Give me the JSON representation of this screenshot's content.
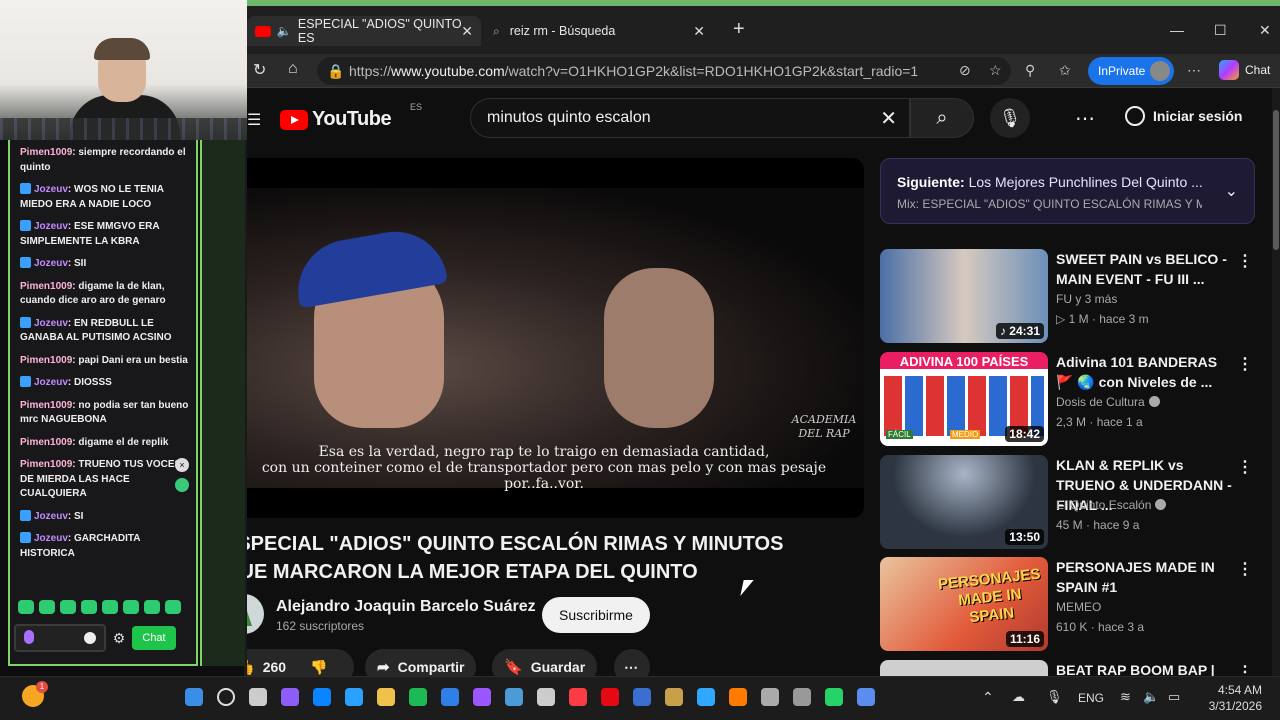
{
  "chat": {
    "messages": [
      {
        "user": "Pimen1009",
        "text": "siempre recordando el quinto",
        "badge": false
      },
      {
        "user": "Jozeuv",
        "text": "WOS NO LE TENIA MIEDO ERA A NADIE LOCO",
        "badge": true
      },
      {
        "user": "Jozeuv",
        "text": "ESE MMGVO ERA SIMPLEMENTE LA KBRA",
        "badge": true
      },
      {
        "user": "Jozeuv",
        "text": "SII",
        "badge": true
      },
      {
        "user": "Pimen1009",
        "text": "digame la de klan, cuando dice aro aro de genaro",
        "badge": false
      },
      {
        "user": "Jozeuv",
        "text": "EN REDBULL LE GANABA AL PUTISIMO ACSINO",
        "badge": true
      },
      {
        "user": "Pimen1009",
        "text": "papi Dani era un bestia",
        "badge": false
      },
      {
        "user": "Jozeuv",
        "text": "DIOSSS",
        "badge": true
      },
      {
        "user": "Pimen1009",
        "text": "no podia ser tan bueno mrc NAGUEBONA",
        "badge": false
      },
      {
        "user": "Pimen1009",
        "text": "digame el de replik",
        "badge": false
      },
      {
        "user": "Pimen1009",
        "text": "TRUENO TUS VOCES DE MIERDA LAS HACE CUALQUIERA",
        "badge": false
      },
      {
        "user": "Jozeuv",
        "text": "SI",
        "badge": true
      },
      {
        "user": "Jozeuv",
        "text": "GARCHADITA HISTORICA",
        "badge": true
      }
    ],
    "send_label": "Chat"
  },
  "browser": {
    "tabs": [
      {
        "label": "ESPECIAL \"ADIOS\" QUINTO ES",
        "active": true
      },
      {
        "label": "reiz rm - Búsqueda",
        "active": false
      }
    ],
    "url_prefix": "https://",
    "url_host": "www.youtube.com",
    "url_path": "/watch?v=O1HKHO1GP2k&list=RDO1HKHO1GP2k&start_radio=1",
    "inprivate_label": "InPrivate",
    "copilot_label": "Chat"
  },
  "youtube": {
    "logo_text": "YouTube",
    "region": "ES",
    "search_value": "minutos quinto escalon",
    "signin_label": "Iniciar sesión",
    "subtitles": [
      "Esa es la verdad, negro rap te lo traigo en demasiada cantidad,",
      "con un conteiner como el de transportador pero con mas pelo y con mas pesaje por..fa..vor."
    ],
    "watermark": "ACADEMIA DEL RAP",
    "video_title": "ESPECIAL \"ADIOS\" QUINTO ESCALÓN RIMAS Y MINUTOS QUE MARCARON LA MEJOR ETAPA DEL QUINTO",
    "channel_name": "Alejandro Joaquin Barcelo Suárez",
    "subscribers": "162 suscriptores",
    "subscribe_label": "Suscribirme",
    "likes": "260",
    "share_label": "Compartir",
    "save_label": "Guardar",
    "up_next_prefix": "Siguiente:",
    "up_next_title": "Los Mejores Punchlines Del Quinto ...",
    "up_next_mix": "Mix: ESPECIAL \"ADIOS\" QUINTO ESCALÓN RIMAS Y MINU",
    "recommendations": [
      {
        "title": "SWEET PAIN vs BELICO - MAIN EVENT - FU III ...",
        "channel": "FU y 3 más",
        "views": "1 M",
        "age": "hace 3 m",
        "duration": "24:31",
        "mix": true,
        "verified": false
      },
      {
        "title": "Adivina 101 BANDERAS 🚩 🌏 con Niveles de ...",
        "channel": "Dosis de Cultura",
        "views": "2,3 M",
        "age": "hace 1 a",
        "duration": "18:42",
        "mix": false,
        "verified": true
      },
      {
        "title": "KLAN & REPLIK vs TRUENO & UNDERDANN - FINAL ...",
        "channel": "El Quinto Escalón",
        "views": "45 M",
        "age": "hace 9 a",
        "duration": "13:50",
        "mix": false,
        "verified": true
      },
      {
        "title": "PERSONAJES MADE IN SPAIN #1",
        "channel": "MEMEO",
        "views": "610 K",
        "age": "hace 3 a",
        "duration": "11:16",
        "mix": false,
        "verified": false
      },
      {
        "title": "BEAT RAP BOOM BAP |",
        "channel": "",
        "views": "",
        "age": "",
        "duration": "",
        "mix": false,
        "verified": false
      }
    ],
    "thumb_texts": {
      "adivina": "ADIVINA 100 PAÍSES",
      "personajes": "PERSONAJES MADE IN SPAIN",
      "facil": "FÁCIL",
      "medio": "MEDIO"
    }
  },
  "taskbar": {
    "language": "ENG",
    "time": "4:54 AM",
    "date": "3/31/2026",
    "weather_badge": "1"
  }
}
